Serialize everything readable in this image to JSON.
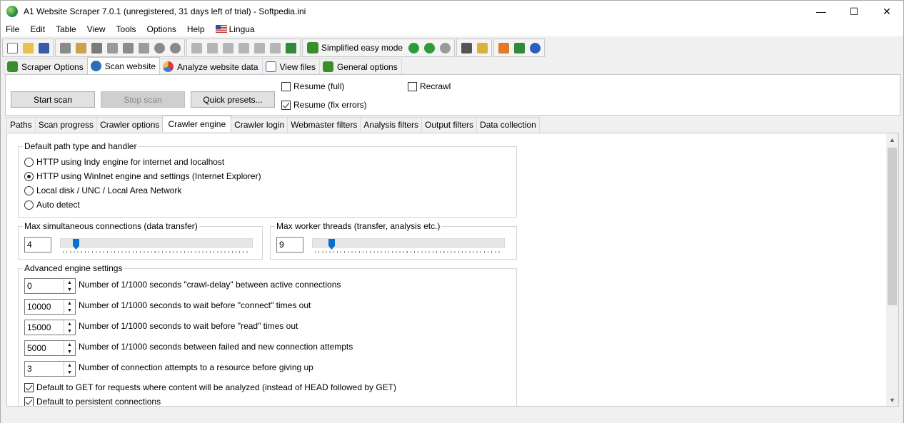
{
  "window": {
    "title": "A1 Website Scraper 7.0.1 (unregistered, 31 days left of trial) - Softpedia.ini",
    "min_glyph": "—",
    "max_glyph": "☐",
    "close_glyph": "✕"
  },
  "menu": [
    "File",
    "Edit",
    "Table",
    "View",
    "Tools",
    "Options",
    "Help",
    "Lingua"
  ],
  "toolbar": {
    "easy_mode_label": "Simplified easy mode"
  },
  "main_tabs": [
    {
      "label": "Scraper Options",
      "icon": "puzzle-icon",
      "color": "#3a8f2a"
    },
    {
      "label": "Scan website",
      "icon": "magnifier-icon",
      "color": "#2a6fb5",
      "active": true
    },
    {
      "label": "Analyze website data",
      "icon": "pie-chart-icon",
      "color": "#d23c3c"
    },
    {
      "label": "View files",
      "icon": "list-icon",
      "color": "#2a6fb5"
    },
    {
      "label": "General options",
      "icon": "puzzle-icon",
      "color": "#3a8f2a"
    }
  ],
  "scan_panel": {
    "start_label": "Start scan",
    "stop_label": "Stop scan",
    "presets_label": "Quick presets...",
    "resume_full_label": "Resume (full)",
    "resume_full_checked": false,
    "resume_fix_label": "Resume (fix errors)",
    "resume_fix_checked": true,
    "recrawl_label": "Recrawl",
    "recrawl_checked": false
  },
  "sub_tabs": [
    "Paths",
    "Scan progress",
    "Crawler options",
    "Crawler engine",
    "Crawler login",
    "Webmaster filters",
    "Analysis filters",
    "Output filters",
    "Data collection"
  ],
  "path_type": {
    "title": "Default path type and handler",
    "options": [
      {
        "label": "HTTP using Indy engine for internet and localhost",
        "selected": false
      },
      {
        "label": "HTTP using WinInet engine and settings (Internet Explorer)",
        "selected": true
      },
      {
        "label": "Local disk / UNC / Local Area Network",
        "selected": false
      },
      {
        "label": "Auto detect",
        "selected": false
      }
    ]
  },
  "max_connections": {
    "title": "Max simultaneous connections (data transfer)",
    "value": "4",
    "slider_fraction": 0.07
  },
  "max_threads": {
    "title": "Max worker threads (transfer, analysis etc.)",
    "value": "9",
    "slider_fraction": 0.09
  },
  "advanced": {
    "title": "Advanced engine settings",
    "spins": [
      {
        "value": "0",
        "label": "Number of 1/1000 seconds \"crawl-delay\" between active connections"
      },
      {
        "value": "10000",
        "label": "Number of 1/1000 seconds to wait before \"connect\" times out"
      },
      {
        "value": "15000",
        "label": "Number of 1/1000 seconds to wait before \"read\" times out"
      },
      {
        "value": "5000",
        "label": "Number of 1/1000 seconds between failed and new connection attempts"
      },
      {
        "value": "3",
        "label": "Number of connection attempts to a resource before giving up"
      }
    ],
    "checks": [
      {
        "label": "Default to GET for requests where content will be analyzed (instead of HEAD followed by GET)",
        "checked": true
      },
      {
        "label": "Default to persistent connections",
        "checked": true
      }
    ]
  }
}
